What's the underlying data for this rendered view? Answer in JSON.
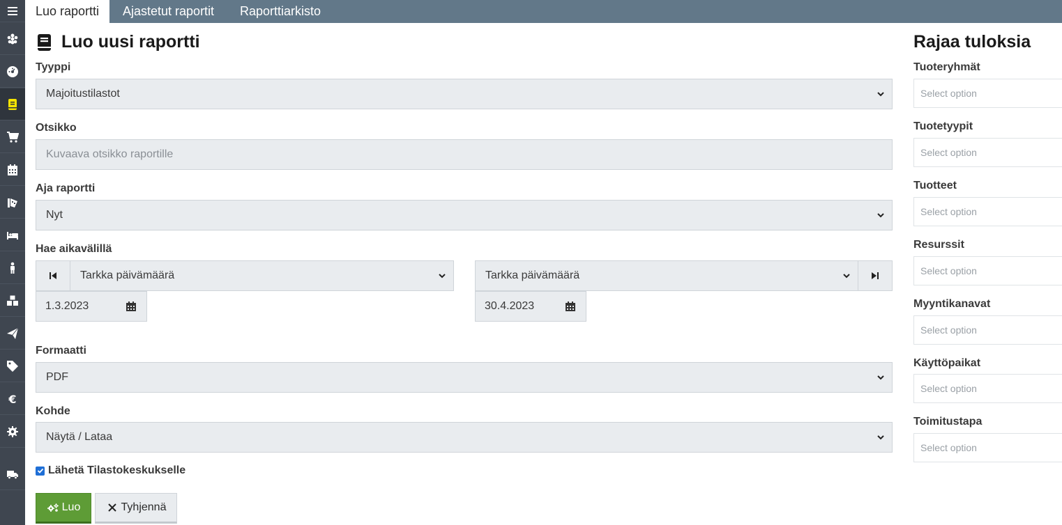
{
  "tabs": [
    {
      "label": "Luo raportti",
      "active": true
    },
    {
      "label": "Ajastetut raportit",
      "active": false
    },
    {
      "label": "Raporttiarkisto",
      "active": false
    }
  ],
  "sidebar": {
    "items": [
      {
        "icon": "menu-icon"
      },
      {
        "icon": "flower-icon"
      },
      {
        "icon": "dashboard-icon"
      },
      {
        "icon": "book-icon",
        "active": true
      },
      {
        "icon": "cart-icon"
      },
      {
        "icon": "calendar-icon"
      },
      {
        "icon": "tickets-icon"
      },
      {
        "icon": "bed-icon"
      },
      {
        "icon": "person-icon"
      },
      {
        "icon": "cubes-icon"
      },
      {
        "icon": "paper-plane-icon"
      },
      {
        "icon": "tag-icon"
      },
      {
        "icon": "euro-icon"
      },
      {
        "icon": "gear-icon"
      },
      {
        "icon": "truck-icon"
      }
    ]
  },
  "form": {
    "title": "Luo uusi raportti",
    "type_label": "Tyyppi",
    "type_value": "Majoitustilastot",
    "heading_label": "Otsikko",
    "heading_placeholder": "Kuvaava otsikko raportille",
    "run_label": "Aja raportti",
    "run_value": "Nyt",
    "range_label": "Hae aikavälillä",
    "range_start_mode": "Tarkka päivämäärä",
    "range_end_mode": "Tarkka päivämäärä",
    "range_start_date": "1.3.2023",
    "range_end_date": "30.4.2023",
    "format_label": "Formaatti",
    "format_value": "PDF",
    "target_label": "Kohde",
    "target_value": "Näytä / Lataa",
    "send_label": "Lähetä Tilastokeskukselle",
    "send_checked": true,
    "create_button": "Luo",
    "clear_button": "Tyhjennä"
  },
  "filters": {
    "title": "Rajaa tuloksia",
    "placeholder": "Select option",
    "items": [
      {
        "label": "Tuoteryhmät"
      },
      {
        "label": "Tuotetyypit"
      },
      {
        "label": "Tuotteet"
      },
      {
        "label": "Resurssit"
      },
      {
        "label": "Myyntikanavat"
      },
      {
        "label": "Käyttöpaikat"
      },
      {
        "label": "Toimitustapa"
      }
    ]
  },
  "colors": {
    "topbar": "#627889",
    "sidebar": "#3f4650",
    "active_icon": "#f5e400",
    "primary_button": "#5e9c36",
    "checkbox": "#1f6fd6"
  }
}
